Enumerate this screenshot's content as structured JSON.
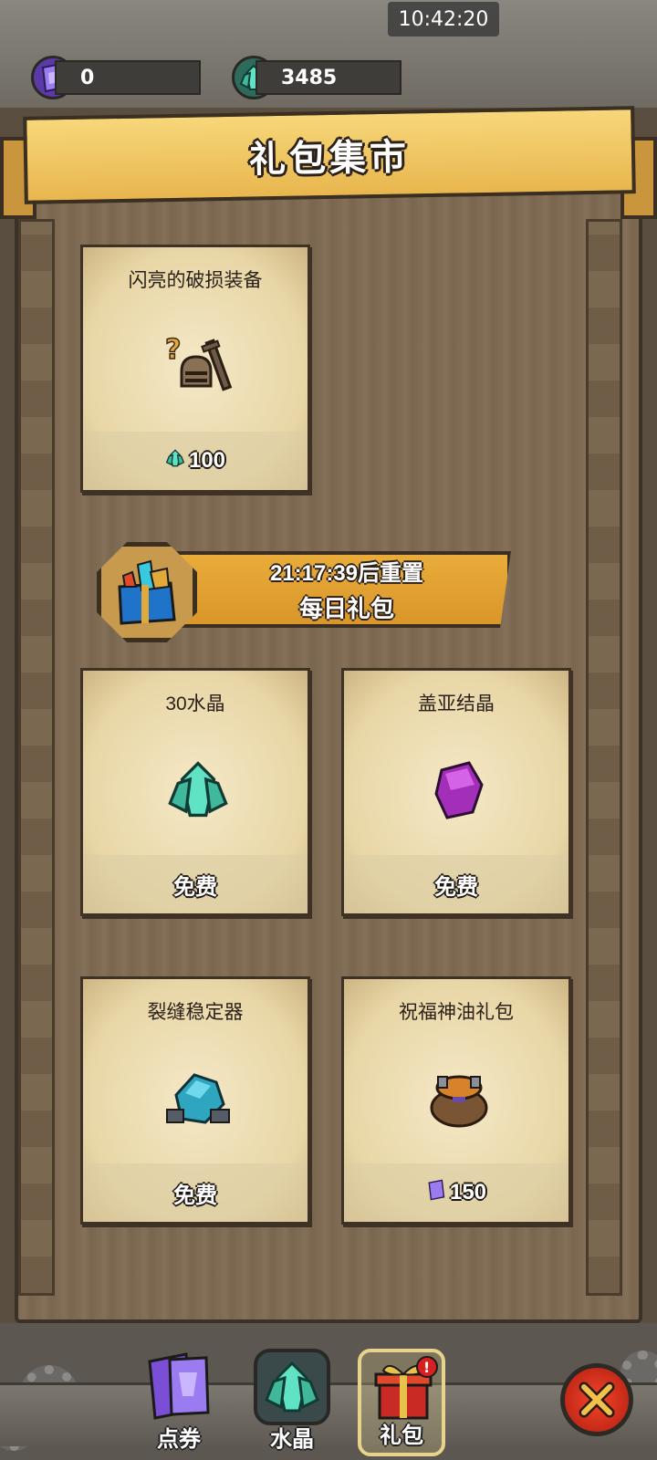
{
  "status_bar": {
    "time": "10:42:20"
  },
  "currencies": {
    "vouchers": {
      "icon": "purple-card-icon",
      "value": "0"
    },
    "crystals": {
      "icon": "teal-crystal-icon",
      "value": "3485"
    }
  },
  "header": {
    "title": "礼包集市"
  },
  "featured": {
    "title": "闪亮的破损装备",
    "icon": "broken-gear-icon",
    "price": "100",
    "price_icon": "teal-crystal-icon"
  },
  "daily": {
    "reset_text": "21:17:39后重置",
    "title": "每日礼包",
    "icon": "gift-box-icon"
  },
  "packs": [
    {
      "title": "30水晶",
      "icon": "teal-crystal-cluster-icon",
      "price": "免费"
    },
    {
      "title": "盖亚结晶",
      "icon": "purple-crystal-icon",
      "price": "免费"
    },
    {
      "title": "裂缝稳定器",
      "icon": "blue-ore-icon",
      "price": "免费"
    },
    {
      "title": "祝福神油礼包",
      "icon": "oil-sack-icon",
      "price": "150",
      "price_icon": "purple-card-icon"
    }
  ],
  "tabs": [
    {
      "label": "点券",
      "icon": "purple-cards-icon"
    },
    {
      "label": "水晶",
      "icon": "teal-crystal-icon"
    },
    {
      "label": "礼包",
      "icon": "red-gift-icon",
      "active": true
    }
  ],
  "colors": {
    "banner": "#f2cc68",
    "paper": "#efe0b8",
    "crystal": "#4fd6b8",
    "voucher": "#7a4fd6",
    "close": "#e0351e"
  }
}
